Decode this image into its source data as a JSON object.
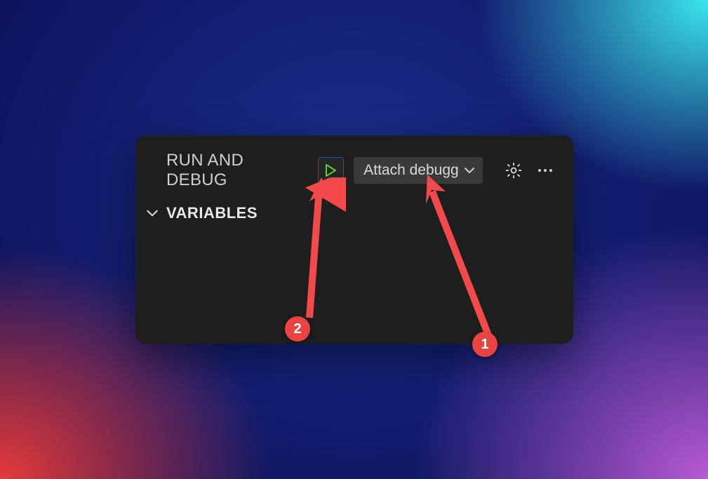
{
  "header": {
    "title": "RUN AND DEBUG",
    "play_tooltip": "Start Debugging",
    "config_selected": "Attach debugg",
    "gear_tooltip": "Open launch.json",
    "more_tooltip": "More Actions"
  },
  "sections": {
    "variables_label": "VARIABLES"
  },
  "annotations": {
    "badge1": "1",
    "badge2": "2"
  },
  "colors": {
    "panel_bg": "#1e1e1e",
    "play_outline": "#0a5fb8",
    "play_fill": "#5bcf3a",
    "annotation": "#e94444"
  }
}
